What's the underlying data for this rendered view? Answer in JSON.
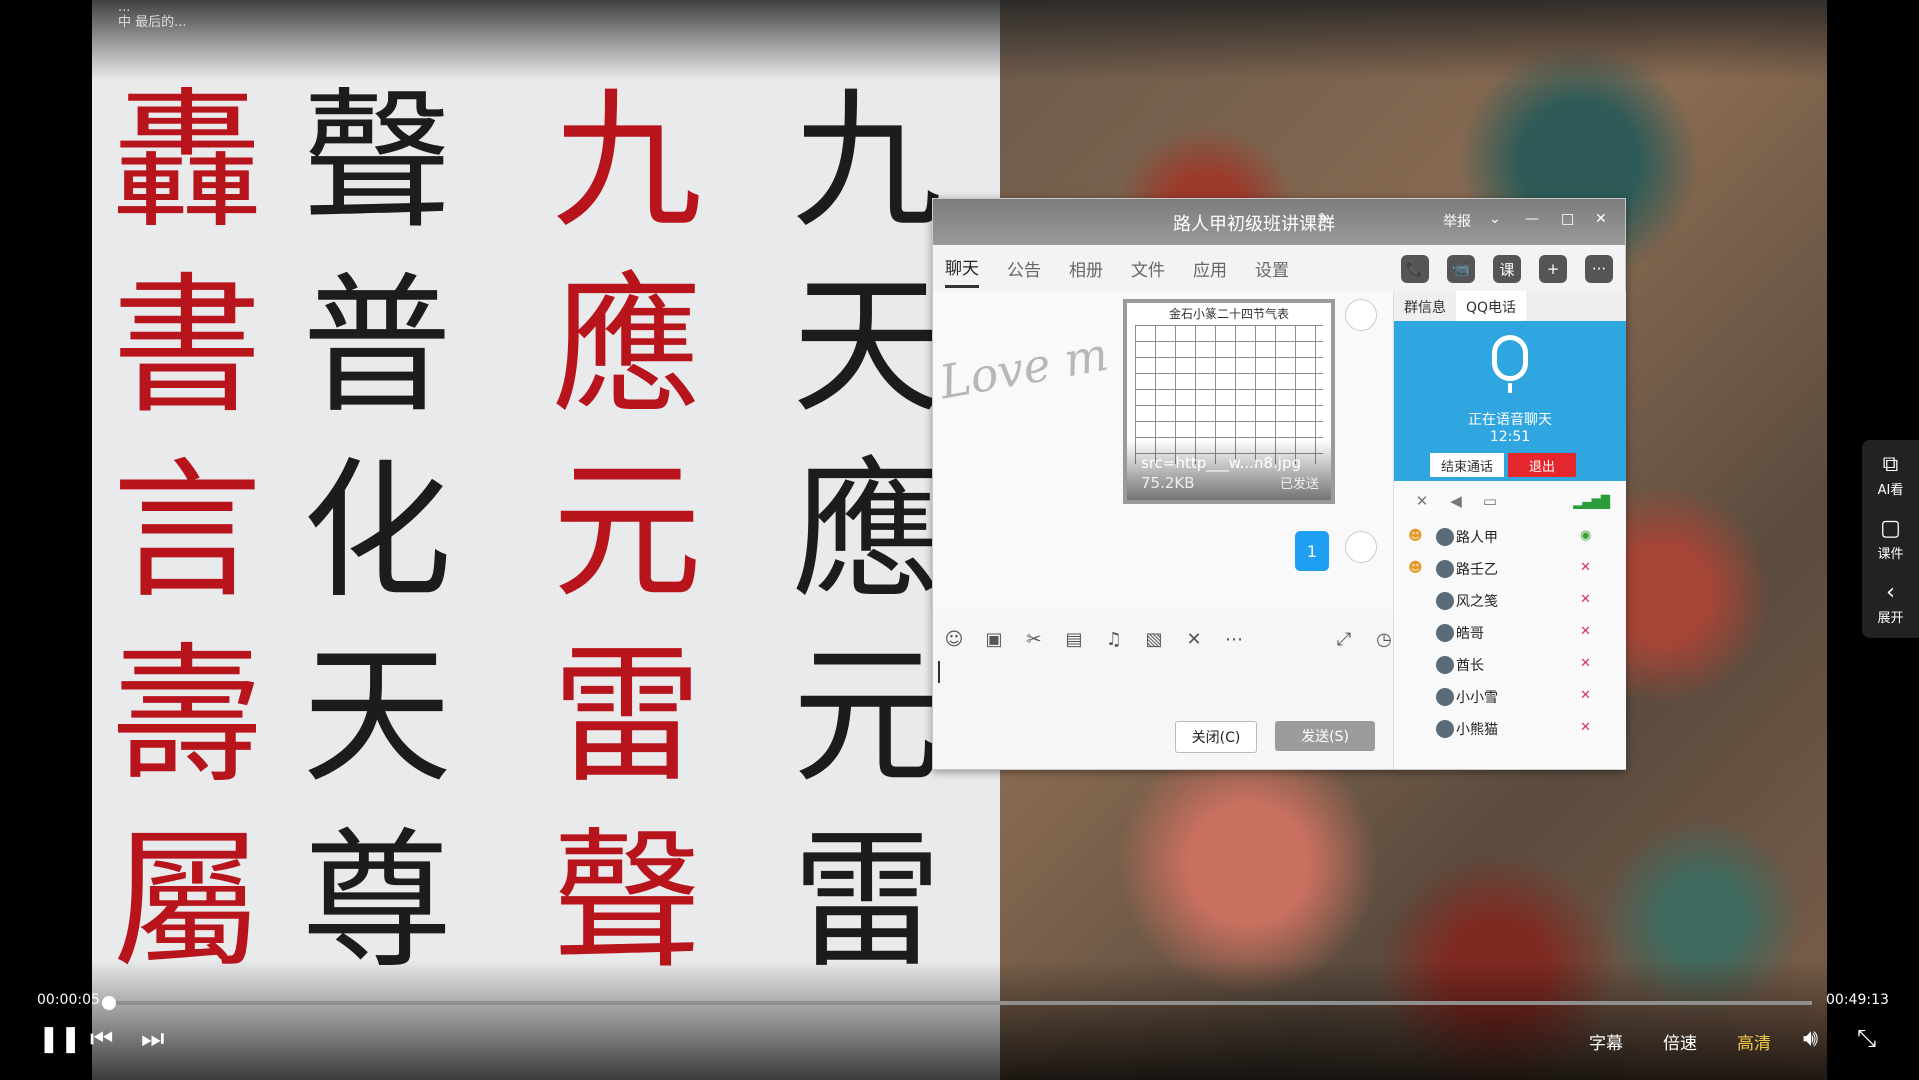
{
  "top_note": {
    "line1": "...",
    "line2": "中 最后的..."
  },
  "calligraphy": {
    "col1": [
      "轟",
      "書",
      "言",
      "壽",
      "屬"
    ],
    "col2": [
      "聲",
      "普",
      "化",
      "天",
      "尊"
    ],
    "col3": [
      "九",
      "應",
      "元",
      "雷",
      "聲"
    ],
    "col4": [
      "九",
      "天",
      "應",
      "元",
      "雷"
    ]
  },
  "chat": {
    "title": "路人甲初级班讲课群",
    "report": "举报",
    "tabs": [
      "聊天",
      "公告",
      "相册",
      "文件",
      "应用",
      "设置"
    ],
    "tab_icons": {
      "call": "📞",
      "video": "📹",
      "course": "课",
      "add": "+",
      "more": "···"
    },
    "image_header": "金石小篆二十四节气表",
    "file_name": "src=http___w...n8.jpg",
    "file_size": "75.2KB",
    "file_status": "已发送",
    "bubble_text": "1",
    "handwriting": "Love m",
    "close_button": "关闭(C)",
    "send_button": "发送(S)",
    "side_tabs": [
      "群信息",
      "QQ电话"
    ],
    "voice_label": "正在语音聊天",
    "voice_time": "12:51",
    "end_call": "结束通话",
    "quit": "退出",
    "members": [
      {
        "name": "路人甲",
        "role": "owner",
        "status": "talking"
      },
      {
        "name": "路壬乙",
        "role": "admin",
        "status": "muted"
      },
      {
        "name": "风之笺",
        "role": "",
        "status": "muted"
      },
      {
        "name": "皓哥",
        "role": "",
        "status": "muted"
      },
      {
        "name": "酋长",
        "role": "",
        "status": "muted"
      },
      {
        "name": "小小雪",
        "role": "",
        "status": "muted"
      },
      {
        "name": "小熊猫",
        "role": "",
        "status": "muted"
      }
    ]
  },
  "side_panel": {
    "ai": "AI看",
    "courseware": "课件",
    "expand": "展开"
  },
  "player": {
    "current_time": "00:00:05",
    "total_time": "00:49:13",
    "progress": 0.002,
    "subtitles": "字幕",
    "speed": "倍速",
    "quality": "高清",
    "accent": "#f2c94c"
  }
}
